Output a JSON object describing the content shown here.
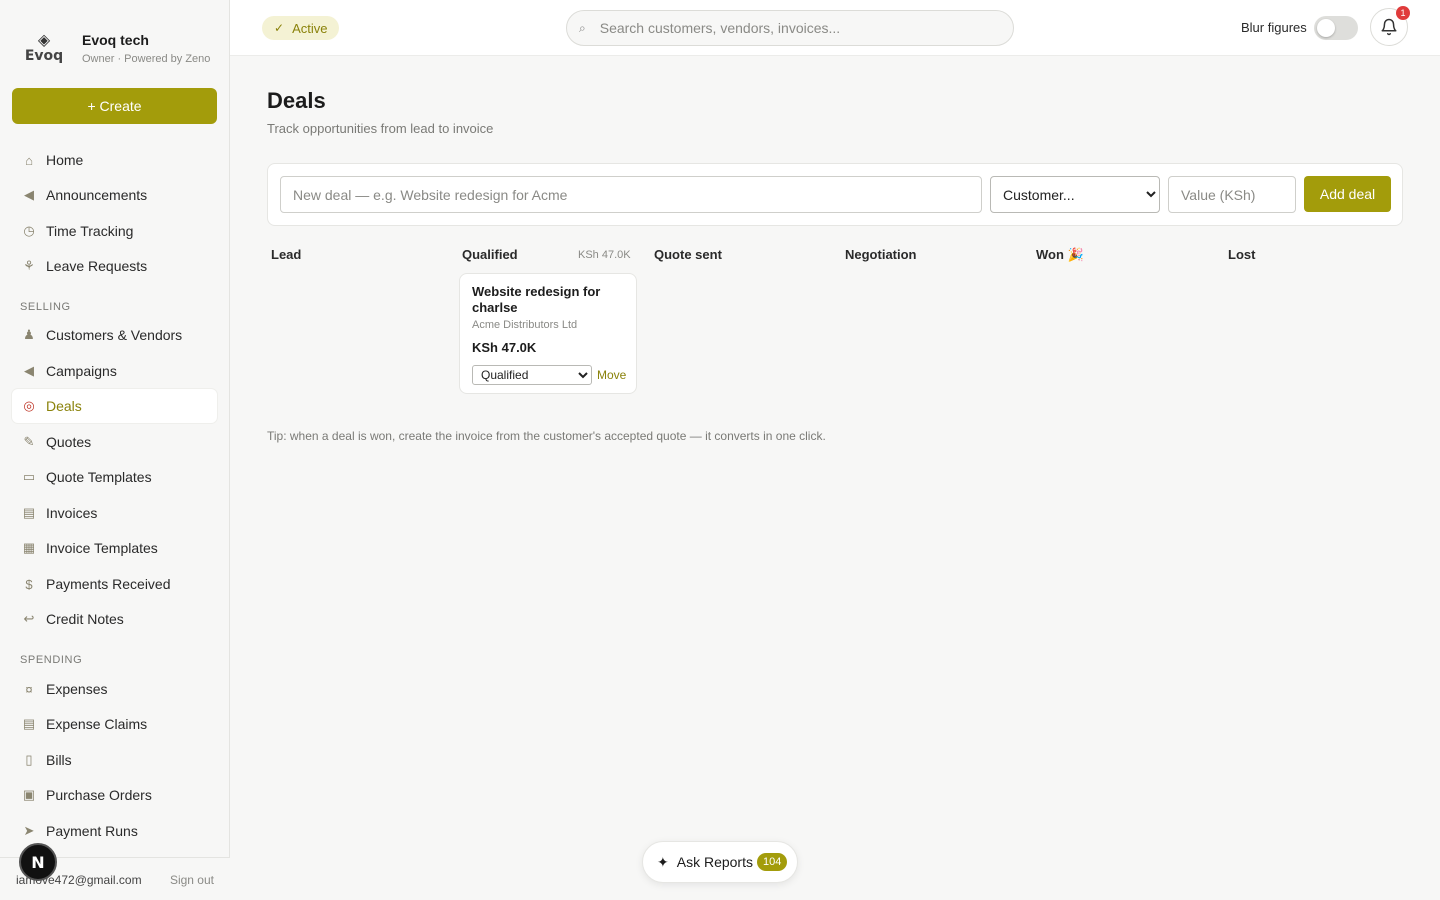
{
  "brand": {
    "logo_text": "Evoq",
    "name": "Evoq tech",
    "subtitle": "Owner · Powered by Zeno"
  },
  "sidebar": {
    "create_label": "+ Create",
    "top_items": [
      {
        "label": "Home",
        "icon": "home-icon"
      },
      {
        "label": "Announcements",
        "icon": "megaphone-icon"
      },
      {
        "label": "Time Tracking",
        "icon": "stopwatch-icon"
      },
      {
        "label": "Leave Requests",
        "icon": "palm-tree-icon"
      }
    ],
    "selling_label": "SELLING",
    "selling_items": [
      {
        "label": "Customers & Vendors",
        "icon": "people-icon"
      },
      {
        "label": "Campaigns",
        "icon": "megaphone-icon"
      },
      {
        "label": "Deals",
        "icon": "target-icon",
        "active": true
      },
      {
        "label": "Quotes",
        "icon": "memo-icon"
      },
      {
        "label": "Quote Templates",
        "icon": "page-icon"
      },
      {
        "label": "Invoices",
        "icon": "receipt-icon"
      },
      {
        "label": "Invoice Templates",
        "icon": "calendar-icon"
      },
      {
        "label": "Payments Received",
        "icon": "money-bag-icon"
      },
      {
        "label": "Credit Notes",
        "icon": "return-icon"
      }
    ],
    "spending_label": "SPENDING",
    "spending_items": [
      {
        "label": "Expenses",
        "icon": "money-wings-icon"
      },
      {
        "label": "Expense Claims",
        "icon": "receipt-icon"
      },
      {
        "label": "Bills",
        "icon": "document-icon"
      },
      {
        "label": "Purchase Orders",
        "icon": "package-icon"
      },
      {
        "label": "Payment Runs",
        "icon": "runner-icon"
      }
    ],
    "footer": {
      "email": "iamove472@gmail.com",
      "signout": "Sign out",
      "avatar_letter": "N"
    }
  },
  "topbar": {
    "status": "Active",
    "search_placeholder": "Search customers, vendors, invoices...",
    "blur_label": "Blur figures",
    "blur_on": false,
    "notification_count": "1"
  },
  "page": {
    "title": "Deals",
    "subtitle": "Track opportunities from lead to invoice"
  },
  "new_deal": {
    "title_placeholder": "New deal — e.g. Website redesign for Acme",
    "customer_selected": "Customer...",
    "value_placeholder": "Value (KSh)",
    "add_label": "Add deal"
  },
  "pipeline": {
    "columns": [
      {
        "name": "Lead",
        "total": ""
      },
      {
        "name": "Qualified",
        "total": "KSh 47.0K"
      },
      {
        "name": "Quote sent",
        "total": ""
      },
      {
        "name": "Negotiation",
        "total": ""
      },
      {
        "name": "Won 🎉",
        "total": ""
      },
      {
        "name": "Lost",
        "total": ""
      }
    ],
    "deals": [
      {
        "title": "Website redesign for charlse",
        "customer": "Acme Distributors Ltd",
        "value": "KSh 47.0K",
        "stage": "Qualified",
        "move_label": "Move"
      }
    ]
  },
  "tip": "Tip: when a deal is won, create the invoice from the customer's accepted quote — it converts in one click.",
  "ask_reports": {
    "label": "Ask Reports",
    "badge": "104"
  },
  "colors": {
    "accent": "#a39c0b",
    "active_text": "#8a820a",
    "active_pill_bg": "#f4f2d4",
    "notification": "#e03b3b"
  }
}
